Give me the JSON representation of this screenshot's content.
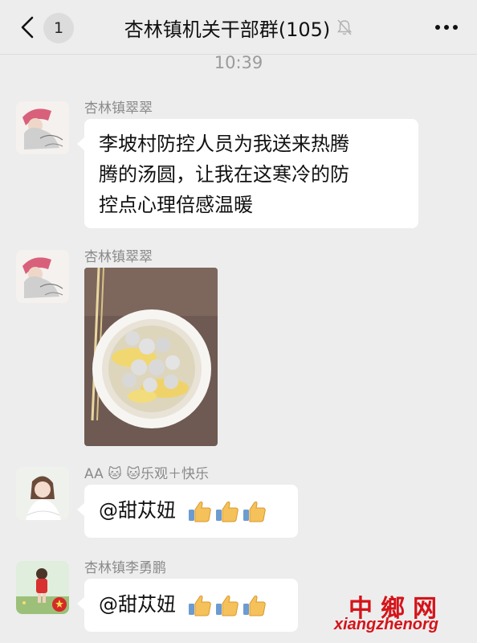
{
  "header": {
    "back_count": "1",
    "title": "杏林镇机关干部群(105)"
  },
  "timestamp": "10:39",
  "messages": [
    {
      "sender": "杏林镇翠翠",
      "lines": [
        "李坡村防控人员为我送来热腾",
        "腾的汤圆，让我在这寒冷的防",
        "控点心理倍感温暖"
      ]
    },
    {
      "sender": "杏林镇翠翠",
      "image": "photo-tangyuan"
    },
    {
      "sender": "AA 🐱 🐱乐观＋快乐",
      "text": "@甜苁妞"
    },
    {
      "sender": "杏林镇李勇鹏",
      "text": "@甜苁妞"
    }
  ],
  "watermark": {
    "cn": "中鄉网",
    "en": "xiangzhenorg"
  },
  "colors": {
    "background": "#ededed",
    "bubble": "#ffffff",
    "watermark": "#d4141a",
    "thumb": "#f5c15a"
  }
}
